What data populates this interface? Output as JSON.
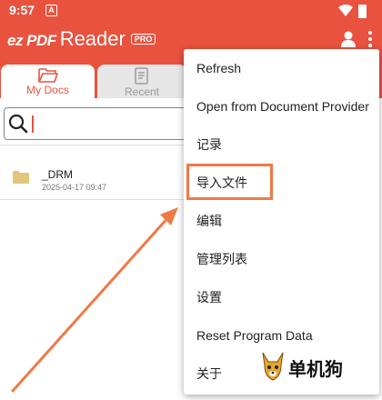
{
  "status": {
    "time": "9:57",
    "notif_glyph": "A"
  },
  "app": {
    "logo_ez": "ez PDF",
    "logo_reader": "Reader",
    "logo_pro": "PRO"
  },
  "tabs": [
    {
      "label": "My Docs",
      "icon": "folder-open-icon"
    },
    {
      "label": "Recent",
      "icon": "recent-doc-icon"
    }
  ],
  "search": {
    "value": "",
    "placeholder": ""
  },
  "files": [
    {
      "name": "_DRM",
      "date": "2025-04-17 09:47",
      "icon": "folder-icon"
    }
  ],
  "menu": {
    "items": [
      {
        "label": "Refresh"
      },
      {
        "label": "Open from Document Provider"
      },
      {
        "label": "记录"
      },
      {
        "label": "导入文件",
        "highlighted": true
      },
      {
        "label": "编辑"
      },
      {
        "label": "管理列表"
      },
      {
        "label": "设置"
      },
      {
        "label": "Reset Program Data"
      },
      {
        "label": "关于"
      }
    ]
  },
  "watermark": {
    "text": "单机狗"
  },
  "colors": {
    "brand": "#e8523e",
    "highlight": "#f07945"
  }
}
